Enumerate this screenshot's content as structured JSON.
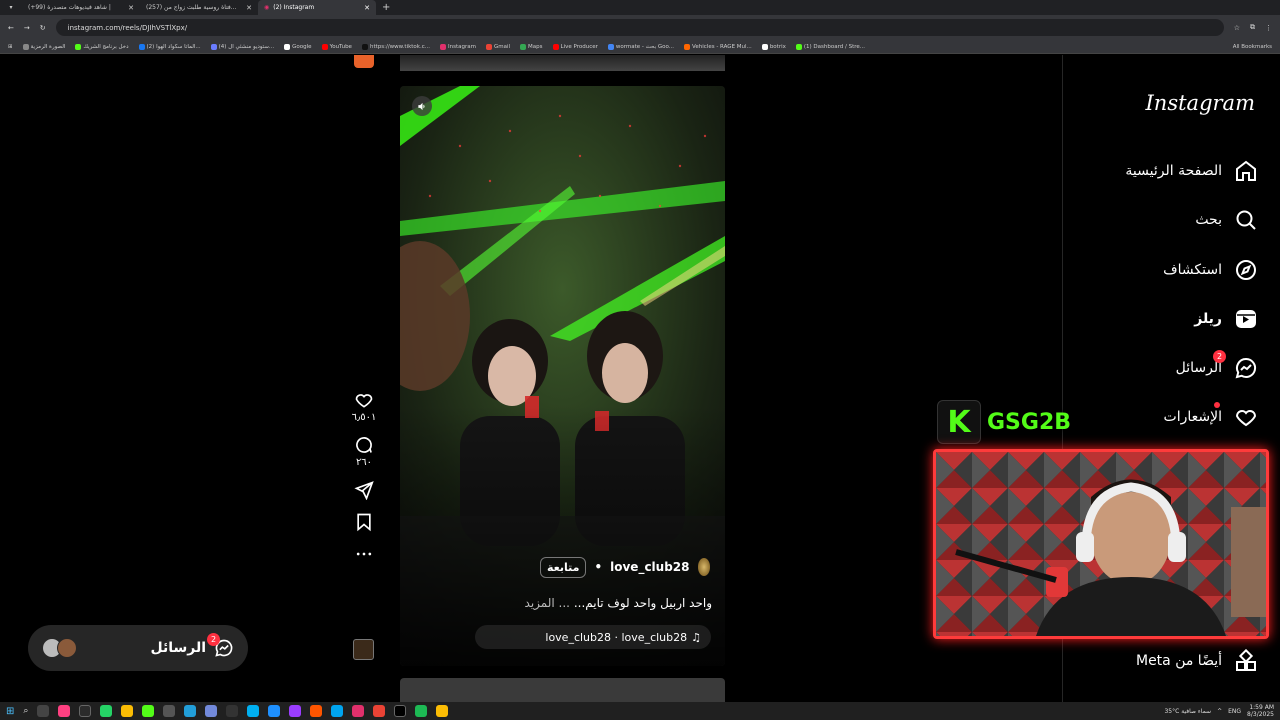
{
  "browser": {
    "tabs": [
      {
        "title": "(+99) شاهد فيديوهات متصدرة |",
        "active": false
      },
      {
        "title": "(257) فتاة روسية طلبت زواج من...",
        "active": false
      },
      {
        "title": "(2) Instagram",
        "active": true
      }
    ],
    "url": "instagram.com/reels/DJIhVSTlXpx/",
    "bookmarks": [
      "الصورة الرمزية",
      "دخل برنامج الشريك",
      "(2) الماتا سكواد الهوا...",
      "(4) ستوديو منشئي ال...",
      "Google",
      "YouTube",
      "https://www.tiktok.c...",
      "Instagram",
      "Gmail",
      "Maps",
      "Live Producer",
      "wormate - بحث Goo...",
      "Vehicles - RAGE Mul...",
      "botrix",
      "(1) Dashboard / Stre..."
    ],
    "all_bookmarks": "All Bookmarks"
  },
  "sidebar": {
    "logo": "Instagram",
    "items": [
      {
        "label": "الصفحة الرئيسية",
        "icon": "home-icon"
      },
      {
        "label": "بحث",
        "icon": "search-icon"
      },
      {
        "label": "استكشاف",
        "icon": "explore-icon"
      },
      {
        "label": "ريلز",
        "icon": "reels-icon"
      },
      {
        "label": "الرسائل",
        "icon": "messenger-icon",
        "badge": "2"
      },
      {
        "label": "الإشعارات",
        "icon": "heart-icon"
      }
    ],
    "more_from_meta": "أيضًا من Meta"
  },
  "reel": {
    "likes": "٦٫٥٠١",
    "comments": "٢٦٠",
    "username": "love_club28",
    "follow": "متابعة",
    "caption": "واحد اربيل واحد لوف تايم...",
    "more": "... المزيد",
    "audio": "love_club28 · love_club28"
  },
  "messages_pill": {
    "label": "الرسائل",
    "badge": "2"
  },
  "stream_overlay": {
    "channel": "GSG2B"
  },
  "taskbar": {
    "weather": "35°C سماء صافية",
    "lang": "ENG",
    "time": "1:59 AM",
    "date": "8/3/2025"
  }
}
